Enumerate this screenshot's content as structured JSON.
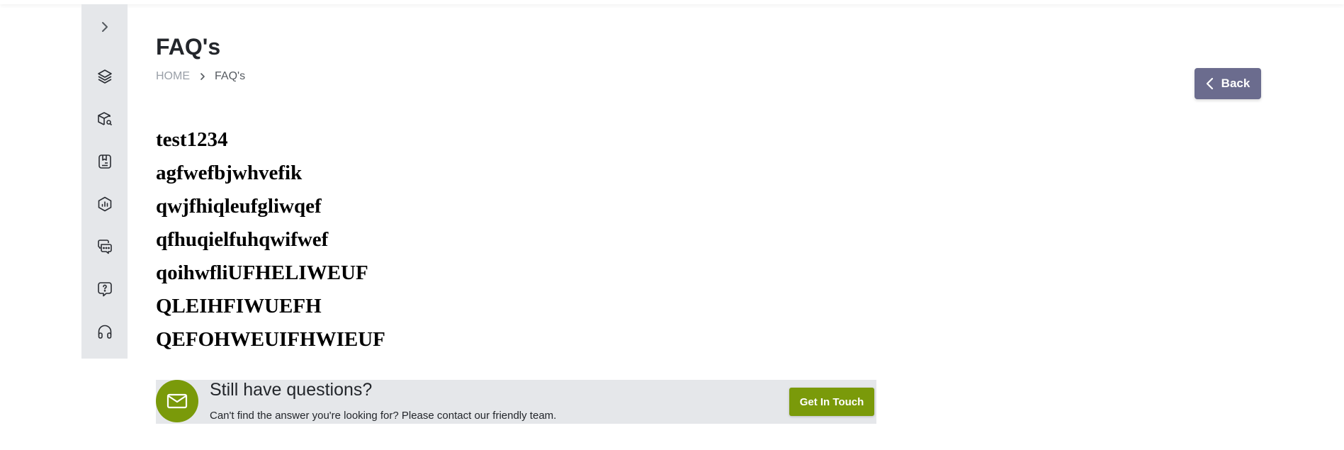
{
  "page": {
    "title": "FAQ's"
  },
  "breadcrumb": {
    "home": "HOME",
    "current": "FAQ's"
  },
  "back_button": {
    "label": "Back"
  },
  "sidebar": {
    "items": [
      {
        "icon": "chevron-right-icon"
      },
      {
        "icon": "layers-icon"
      },
      {
        "icon": "box-search-icon"
      },
      {
        "icon": "document-list-icon"
      },
      {
        "icon": "hexagon-chart-icon"
      },
      {
        "icon": "chat-bubbles-icon"
      },
      {
        "icon": "question-bubble-icon"
      },
      {
        "icon": "headphones-icon"
      }
    ]
  },
  "faqs": [
    "test1234",
    "agfwefbjwhvefik",
    "qwjfhiqleufgliwqef",
    "qfhuqielfuhqwifwef",
    "qoihwfliUFHELIWEUF",
    "QLEIHFIWUEFH",
    "QEFOHWEUIFHWIEUF"
  ],
  "contact": {
    "title": "Still have questions?",
    "subtitle": "Can't find the answer you're looking for? Please contact our friendly team.",
    "button_label": "Get In Touch"
  },
  "colors": {
    "accent_green": "#7a9a0a",
    "back_button": "#6b6c8e",
    "sidebar_bg": "#e5e7ea"
  }
}
